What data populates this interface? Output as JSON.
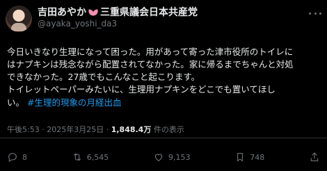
{
  "header": {
    "display_name": "吉田あやか",
    "party": "三重県議会日本共産党",
    "handle": "@ayaka_yoshi_da3"
  },
  "tweet": {
    "line1": "今日いきなり生理になって困った。用があって寄った津市役所のトイレに",
    "line2": "はナプキンは残念ながら配置されてなかった。家に帰るまでちゃんと対処",
    "line3": "できなかった。27歳でもこんなこと起こります。",
    "line4": "トイレットペーパーみたいに、生理用ナプキンをどこでも置いてほし",
    "line5_prefix": "い。",
    "hashtag": "#生理的現象の月経出血"
  },
  "meta": {
    "time": "午後5:53",
    "sep1": "·",
    "date": "2025年3月25日",
    "sep2": "·",
    "views_count": "1,848.4万",
    "views_label": "件の表示"
  },
  "actions": {
    "replies": "8",
    "reposts": "6,545",
    "likes": "9,153",
    "bookmarks": "748"
  },
  "icons": [
    "avatar",
    "lotus-icon",
    "more-icon",
    "reply-icon",
    "repost-icon",
    "like-icon",
    "bookmark-icon",
    "share-icon"
  ],
  "colors": {
    "background": "#000000",
    "text": "#e7e9ea",
    "muted": "#71767b",
    "link": "#1d9bf0"
  }
}
